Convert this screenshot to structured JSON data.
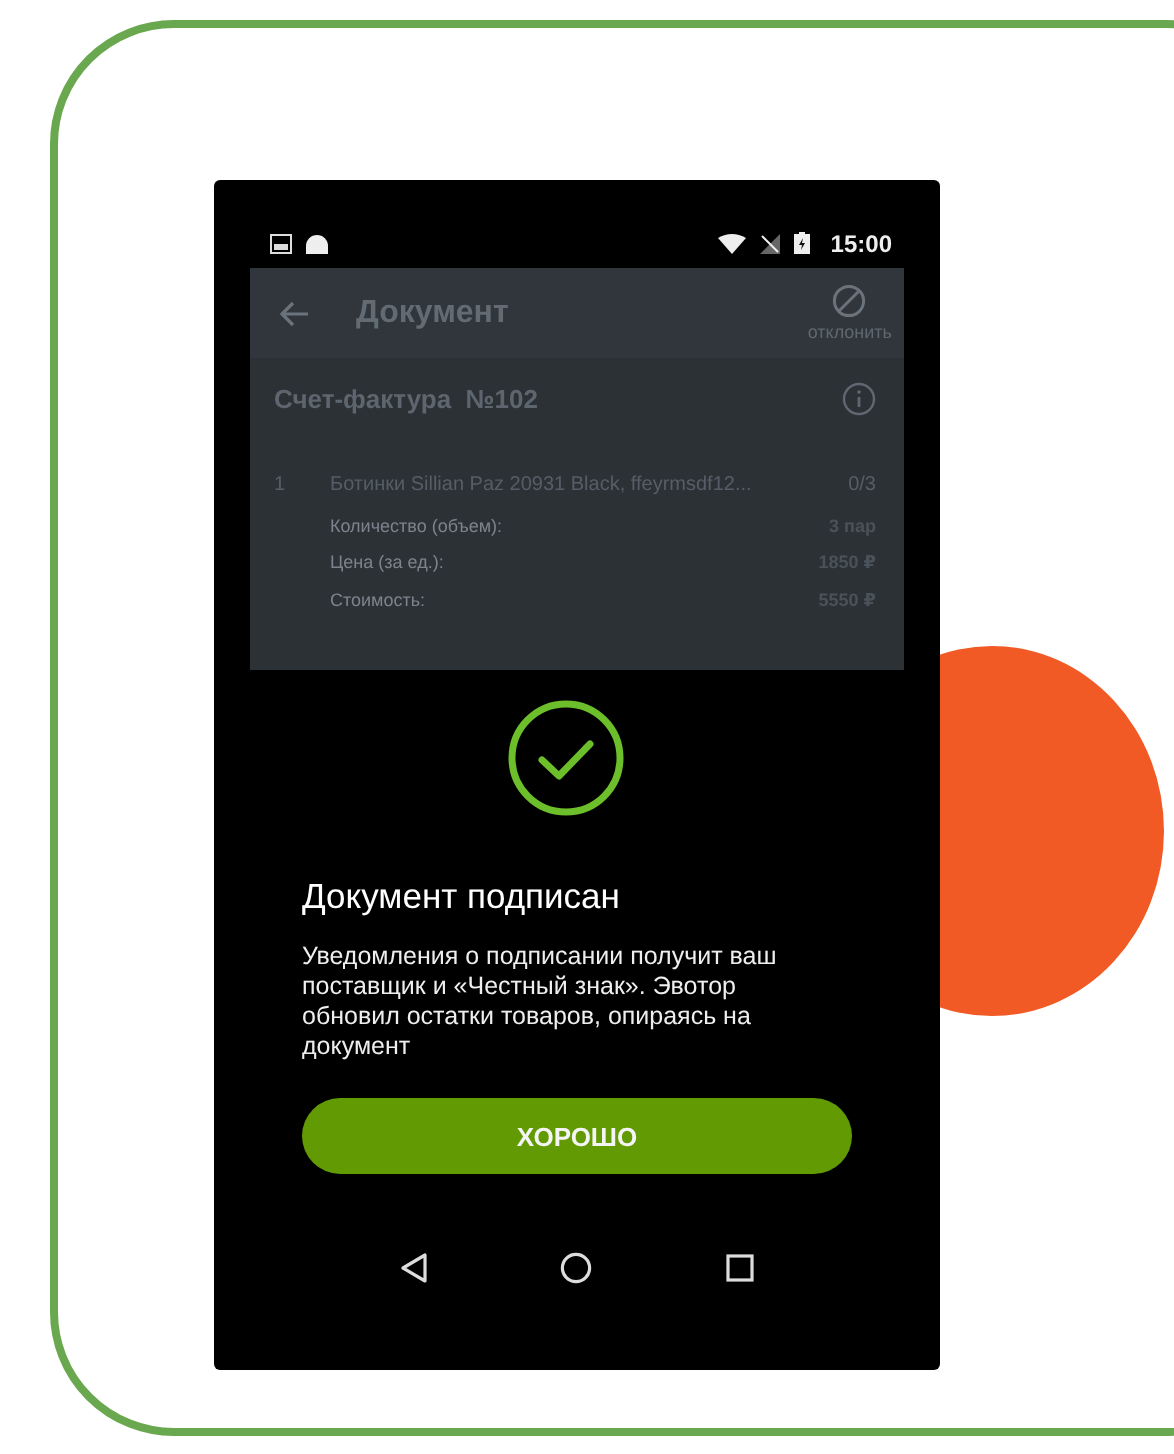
{
  "status_bar": {
    "time": "15:00"
  },
  "app_bar": {
    "title": "Документ",
    "action": "отклонить"
  },
  "invoice": {
    "title": "Счет-фактура  №102",
    "items": [
      {
        "number": "1",
        "name": "Ботинки Sillian Paz 20931 Black, ffeyrmsdf12...",
        "count": "0/3",
        "details": [
          {
            "label": "Количество (объем):",
            "value": "3 пар"
          },
          {
            "label": "Цена (за ед.):",
            "value": "1850 ₽"
          },
          {
            "label": "Стоимость:",
            "value": "5550 ₽"
          }
        ]
      }
    ]
  },
  "dialog": {
    "title": "Документ подписан",
    "message": "Уведомления о подписании получит ваш поставщик и «Честный знак». Эвотор обновил остатки товаров, опираясь на документ",
    "button": "ХОРОШО"
  }
}
